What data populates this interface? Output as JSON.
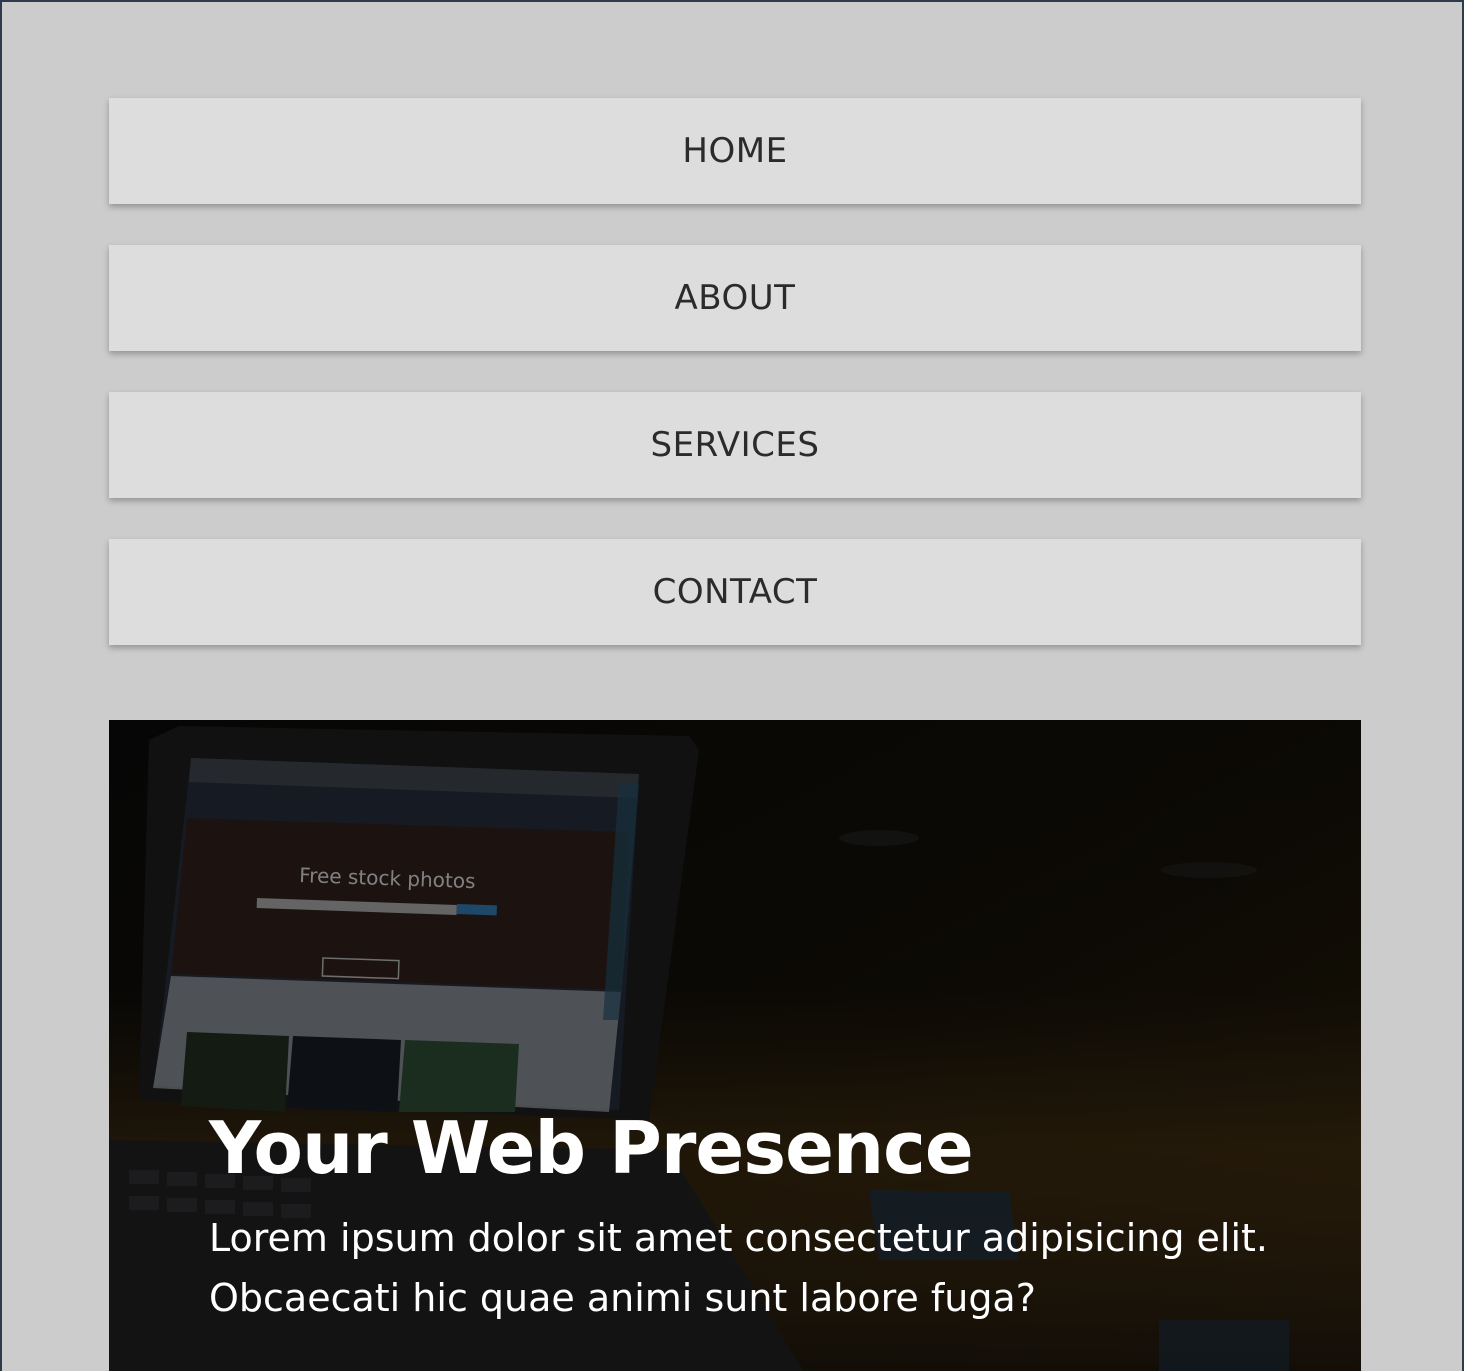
{
  "nav": {
    "items": [
      {
        "label": "HOME"
      },
      {
        "label": "ABOUT"
      },
      {
        "label": "SERVICES"
      },
      {
        "label": "CONTACT"
      }
    ]
  },
  "hero": {
    "title": "Your Web Presence",
    "subtitle": "Lorem ipsum dolor sit amet consectetur adipisicing elit. Obcaecati hic quae animi sunt labore fuga?",
    "screen_headline": "Free stock photos"
  },
  "colors": {
    "page_bg": "#cccccc",
    "nav_bg": "#dddddd",
    "nav_text": "#2b2b2b",
    "frame_border": "#2e3b4c",
    "hero_text": "#ffffff"
  }
}
